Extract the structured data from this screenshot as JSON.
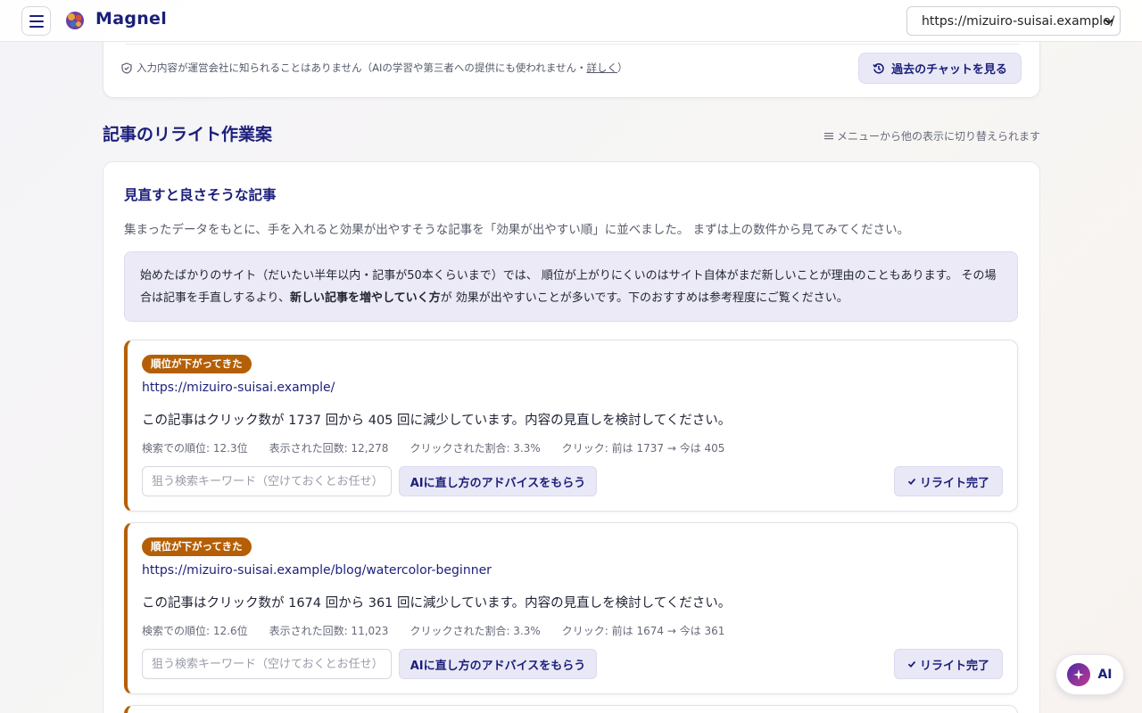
{
  "header": {
    "brand_name": "Magnel",
    "site_selected": "https://mizuiro-suisai.example/"
  },
  "top_card": {
    "privacy_text": "入力内容が運営会社に知られることはありません（AIの学習や第三者への提供にも使われません・",
    "privacy_link": "詳しく",
    "privacy_close": "）",
    "history_button": "過去のチャットを見る"
  },
  "section": {
    "title": "記事のリライト作業案",
    "menu_hint": "メニューから他の表示に切り替えられます"
  },
  "card": {
    "heading": "見直すと良さそうな記事",
    "description": "集まったデータをもとに、手を入れると効果が出やすそうな記事を「効果が出やすい順」に並べました。 まずは上の数件から見てみてください。",
    "notice_part1": "始めたばかりのサイト（だいたい半年以内・記事が50本くらいまで）では、 順位が上がりにくいのはサイト自体がまだ新しいことが理由のこともあります。 その場合は記事を手直しするより、",
    "notice_bold": "新しい記事を増やしていく方",
    "notice_part2": "が 効果が出やすいことが多いです。下のおすすめは参考程度にご覧ください。"
  },
  "items": [
    {
      "badge": "順位が下がってきた",
      "url": "https://mizuiro-suisai.example/",
      "message": "この記事はクリック数が 1737 回から 405 回に減少しています。内容の見直しを検討してください。",
      "rank": "検索での順位: 12.3位",
      "impressions": "表示された回数: 12,278",
      "ctr": "クリックされた割合: 3.3%",
      "clicks": "クリック: 前は 1737 → 今は 405",
      "keyword_placeholder": "狙う検索キーワード（空けておくとお任せ）",
      "advice_button": "AIに直し方のアドバイスをもらう",
      "done_button": "リライト完了"
    },
    {
      "badge": "順位が下がってきた",
      "url": "https://mizuiro-suisai.example/blog/watercolor-beginner",
      "message": "この記事はクリック数が 1674 回から 361 回に減少しています。内容の見直しを検討してください。",
      "rank": "検索での順位: 12.6位",
      "impressions": "表示された回数: 11,023",
      "ctr": "クリックされた割合: 3.3%",
      "clicks": "クリック: 前は 1674 → 今は 361",
      "keyword_placeholder": "狙う検索キーワード（空けておくとお任せ）",
      "advice_button": "AIに直し方のアドバイスをもらう",
      "done_button": "リライト完了"
    }
  ],
  "ai_fab": {
    "label": "AI"
  }
}
